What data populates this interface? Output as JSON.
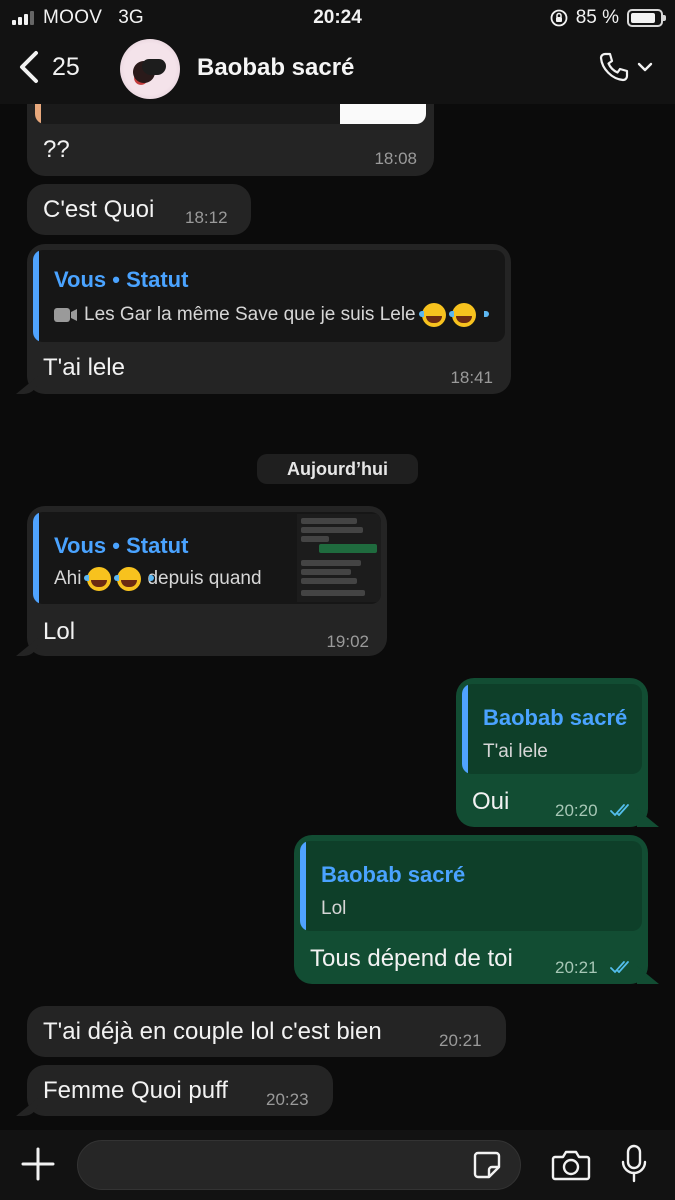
{
  "status_bar": {
    "carrier": "MOOV",
    "network": "3G",
    "time": "20:24",
    "battery_text": "85 %",
    "battery_level": 0.85
  },
  "header": {
    "back_count": "25",
    "contact_name": "Baobab sacré",
    "call_icon": "phone-icon"
  },
  "messages": [
    {
      "id": "m1",
      "text": "??",
      "time": "18:08"
    },
    {
      "id": "m2",
      "text": "C'est Quoi",
      "time": "18:12"
    },
    {
      "id": "m3",
      "text": "T'ai lele",
      "time": "18:41",
      "quote": {
        "author": "Vous • Statut",
        "text": "Les Gar la même Save que je suis Lele"
      }
    },
    {
      "id": "m4",
      "text": "Lol",
      "time": "19:02",
      "quote": {
        "author": "Vous • Statut",
        "text_before": "Ahi",
        "text_after": "depuis quand"
      }
    },
    {
      "id": "m5",
      "text": "Oui",
      "time": "20:20",
      "outgoing": true,
      "quote": {
        "author": "Baobab sacré",
        "text": "T'ai lele"
      }
    },
    {
      "id": "m6",
      "text": "Tous dépend de toi",
      "time": "20:21",
      "outgoing": true,
      "quote": {
        "author": "Baobab sacré",
        "text": "Lol"
      }
    },
    {
      "id": "m7",
      "text": "T'ai déjà en couple lol c'est bien",
      "time": "20:21"
    },
    {
      "id": "m8",
      "text": "Femme Quoi puff",
      "time": "20:23"
    }
  ],
  "day_separator": "Aujourd’hui",
  "input": {
    "placeholder": ""
  },
  "colors": {
    "background": "#0b0b0b",
    "incoming_bubble": "#242424",
    "outgoing_bubble": "#124d33",
    "quote_accent": "#4fa3ff",
    "read_ticks": "#53bdeb"
  }
}
